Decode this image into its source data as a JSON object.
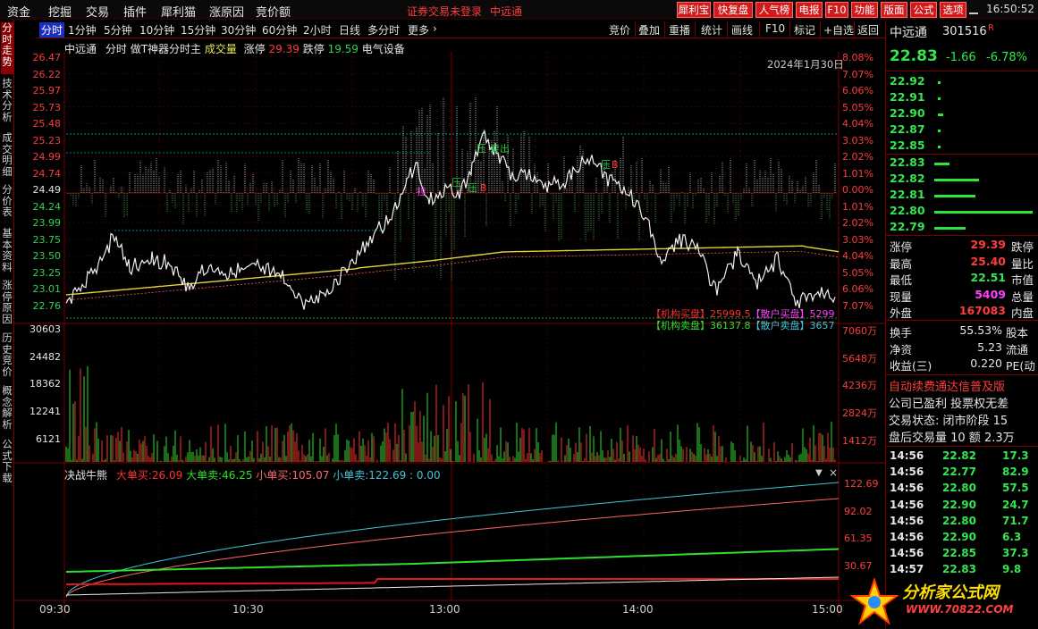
{
  "menubar": {
    "items": [
      "资金",
      "挖掘",
      "交易",
      "插件",
      "犀利猫",
      "涨原因",
      "竞价额"
    ],
    "notice": "证券交易未登录",
    "notice_stock": "中远通",
    "buttons": [
      "犀利宝",
      "快复盘",
      "人气榜",
      "电报",
      "F10",
      "功能",
      "版面",
      "公式",
      "选项"
    ],
    "clock": "16:50:52"
  },
  "lefttabs": [
    "分时走势",
    "技术分析",
    "成交明细",
    "分价表",
    "基本资料",
    "涨停原因",
    "历史竞价",
    "概念解析",
    "公式下载"
  ],
  "periodbar": {
    "tabs": [
      "分时",
      "1分钟",
      "5分钟",
      "10分钟",
      "15分钟",
      "30分钟",
      "60分钟",
      "2小时",
      "日线",
      "多分时",
      "更多"
    ],
    "active": "分时"
  },
  "toolbar": [
    "竞价",
    "叠加",
    "重播",
    "统计",
    "画线",
    "F10",
    "标记",
    "+自选",
    "返回"
  ],
  "info": {
    "name": "中远通",
    "period": "分时",
    "indicator": "做T神器分时主",
    "vol_label": "成交量",
    "limit_up_label": "涨停",
    "limit_up": "29.39",
    "limit_down_label": "跌停",
    "limit_down": "19.59",
    "industry": "电气设备",
    "date": "2024年1月30日"
  },
  "price_axis": {
    "left": [
      "26.47",
      "26.22",
      "25.97",
      "25.73",
      "25.48",
      "25.23",
      "24.99",
      "24.74",
      "24.49",
      "24.24",
      "23.99",
      "23.75",
      "23.50",
      "23.25",
      "23.01",
      "22.76"
    ],
    "right": [
      "8.08%",
      "7.07%",
      "6.06%",
      "5.05%",
      "4.04%",
      "3.03%",
      "2.02%",
      "1.01%",
      "0.00%",
      "1.01%",
      "2.02%",
      "3.03%",
      "4.04%",
      "5.05%",
      "6.06%",
      "7.07%"
    ]
  },
  "volume_axis": {
    "left": [
      "30603",
      "24482",
      "18362",
      "12241",
      "6121"
    ],
    "right": [
      "7060万",
      "5648万",
      "4236万",
      "2824万",
      "1412万"
    ]
  },
  "flow_axis": [
    "122.69",
    "92.02",
    "61.35",
    "30.67"
  ],
  "chart_marks": [
    {
      "text": "拉",
      "color": "#ff40ff"
    },
    {
      "text": "压",
      "color": "#22cc44"
    },
    {
      "text": "压",
      "color": "#22cc44"
    },
    {
      "text": "B",
      "color": "#ff3030"
    },
    {
      "text": "压",
      "color": "#22cc44"
    },
    {
      "text": "卖出",
      "color": "#22cc44"
    },
    {
      "text": "压",
      "color": "#22cc44"
    },
    {
      "text": "B",
      "color": "#ff3030"
    }
  ],
  "institution": {
    "buy_label": "【机构买盘】",
    "buy": "25999.5",
    "sell_label": "【机构卖盘】",
    "sell": "36137.8",
    "retail_buy_label": "【散户买盘】",
    "retail_buy": "5299",
    "retail_sell_label": "【散户卖盘】",
    "retail_sell": "3657"
  },
  "flow": {
    "title": "决战牛熊",
    "big_buy_label": "大单买:",
    "big_buy": "26.09",
    "big_sell_label": "大单卖:",
    "big_sell": "46.25",
    "small_buy_label": "小单买:",
    "small_buy": "105.07",
    "small_sell_label": "小单卖:",
    "small_sell": "122.69 : 0.00"
  },
  "times": [
    "09:30",
    "10:30",
    "13:00",
    "14:00",
    "15:00"
  ],
  "quote": {
    "name": "中远通",
    "code": "301516",
    "flag": "R",
    "price": "22.83",
    "change": "-1.66",
    "pct": "-6.78%"
  },
  "orderbook": {
    "asks": [
      {
        "price": "22.92",
        "vol": 0.01
      },
      {
        "price": "22.91",
        "vol": 0.01
      },
      {
        "price": "22.90",
        "vol": 0.05
      },
      {
        "price": "22.87",
        "vol": 0.03
      },
      {
        "price": "22.85",
        "vol": 0.02
      }
    ],
    "bids": [
      {
        "price": "22.83",
        "vol": 0.15
      },
      {
        "price": "22.82",
        "vol": 0.45
      },
      {
        "price": "22.81",
        "vol": 0.42
      },
      {
        "price": "22.80",
        "vol": 1.0
      },
      {
        "price": "22.79",
        "vol": 0.32
      }
    ]
  },
  "stats": [
    {
      "l": "涨停",
      "v": "29.39",
      "l2": "跌停"
    },
    {
      "l": "最高",
      "v": "25.40",
      "l2": "量比"
    },
    {
      "l": "最低",
      "v": "22.51",
      "l2": "市值"
    },
    {
      "l": "现量",
      "v": "5409",
      "l2": "总量"
    },
    {
      "l": "外盘",
      "v": "167083",
      "l2": "内盘"
    }
  ],
  "stats2": [
    {
      "l": "换手",
      "v": "55.53%",
      "l2": "股本"
    },
    {
      "l": "净资",
      "v": "5.23",
      "l2": "流通"
    },
    {
      "l": "收益(三)",
      "v": "0.220",
      "l2": "PE(动"
    }
  ],
  "notes": [
    "自动续费通达信普及版",
    "公司已盈利 投票权无差",
    "交易状态: 闭市阶段 15",
    "盘后交易量 10 额 2.3万"
  ],
  "ticks": [
    {
      "t": "14:56",
      "p": "22.82",
      "v": "17.3"
    },
    {
      "t": "14:56",
      "p": "22.77",
      "v": "82.9"
    },
    {
      "t": "14:56",
      "p": "22.80",
      "v": "57.5"
    },
    {
      "t": "14:56",
      "p": "22.90",
      "v": "24.7"
    },
    {
      "t": "14:56",
      "p": "22.80",
      "v": "71.7"
    },
    {
      "t": "14:56",
      "p": "22.90",
      "v": "6.3"
    },
    {
      "t": "14:56",
      "p": "22.85",
      "v": "37.3"
    },
    {
      "t": "14:57",
      "p": "22.83",
      "v": "9.8"
    }
  ],
  "logo": {
    "name": "分析家公式网",
    "url": "WWW.70822.COM"
  }
}
